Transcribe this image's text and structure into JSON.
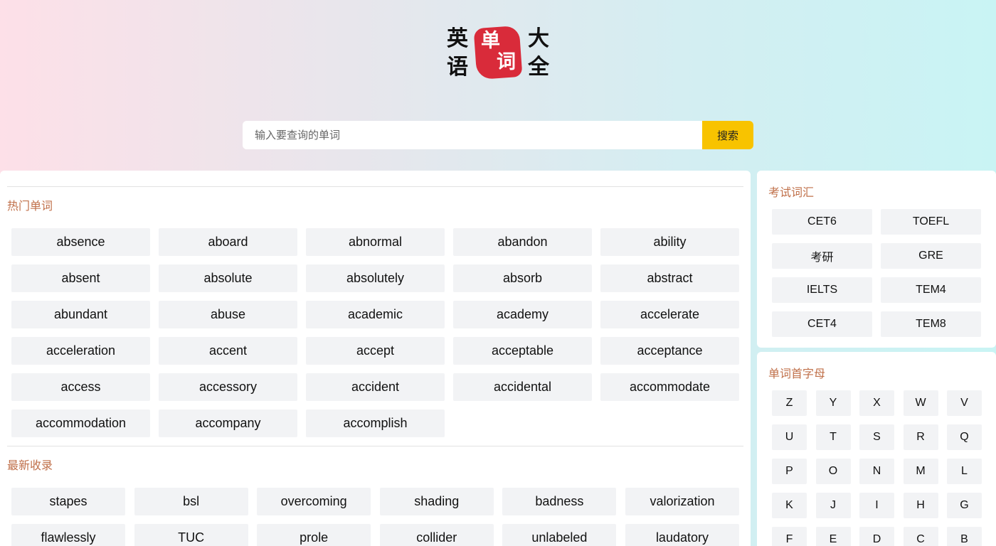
{
  "logo": {
    "chars": [
      "英",
      "语",
      "单",
      "词",
      "大",
      "全"
    ]
  },
  "search": {
    "placeholder": "输入要查询的单词",
    "button_label": "搜索"
  },
  "hot_words": {
    "title": "热门单词",
    "items": [
      "absence",
      "aboard",
      "abnormal",
      "abandon",
      "ability",
      "absent",
      "absolute",
      "absolutely",
      "absorb",
      "abstract",
      "abundant",
      "abuse",
      "academic",
      "academy",
      "accelerate",
      "acceleration",
      "accent",
      "accept",
      "acceptable",
      "acceptance",
      "access",
      "accessory",
      "accident",
      "accidental",
      "accommodate",
      "accommodation",
      "accompany",
      "accomplish"
    ]
  },
  "new_words": {
    "title": "最新收录",
    "items": [
      "stapes",
      "bsl",
      "overcoming",
      "shading",
      "badness",
      "valorization",
      "flawlessly",
      "TUC",
      "prole",
      "collider",
      "unlabeled",
      "laudatory"
    ]
  },
  "exam_vocab": {
    "title": "考试词汇",
    "items": [
      "CET6",
      "TOEFL",
      "考研",
      "GRE",
      "IELTS",
      "TEM4",
      "CET4",
      "TEM8"
    ]
  },
  "letters": {
    "title": "单词首字母",
    "items": [
      "Z",
      "Y",
      "X",
      "W",
      "V",
      "U",
      "T",
      "S",
      "R",
      "Q",
      "P",
      "O",
      "N",
      "M",
      "L",
      "K",
      "J",
      "I",
      "H",
      "G",
      "F",
      "E",
      "D",
      "C",
      "B"
    ]
  }
}
